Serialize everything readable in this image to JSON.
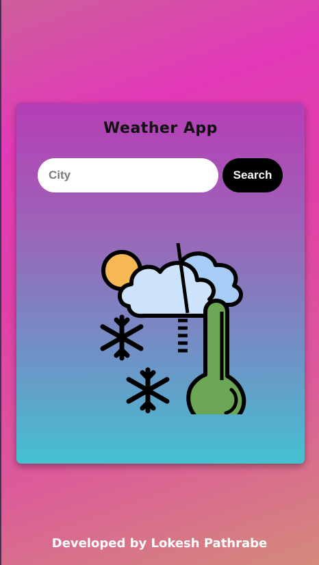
{
  "app": {
    "title": "Weather App"
  },
  "search": {
    "placeholder": "City",
    "value": "",
    "button_label": "Search"
  },
  "weather": {
    "icon": "cold-cloudy-thermometer-illustration"
  },
  "footer": {
    "credit": "Developed by Lokesh Pathrabe"
  }
}
